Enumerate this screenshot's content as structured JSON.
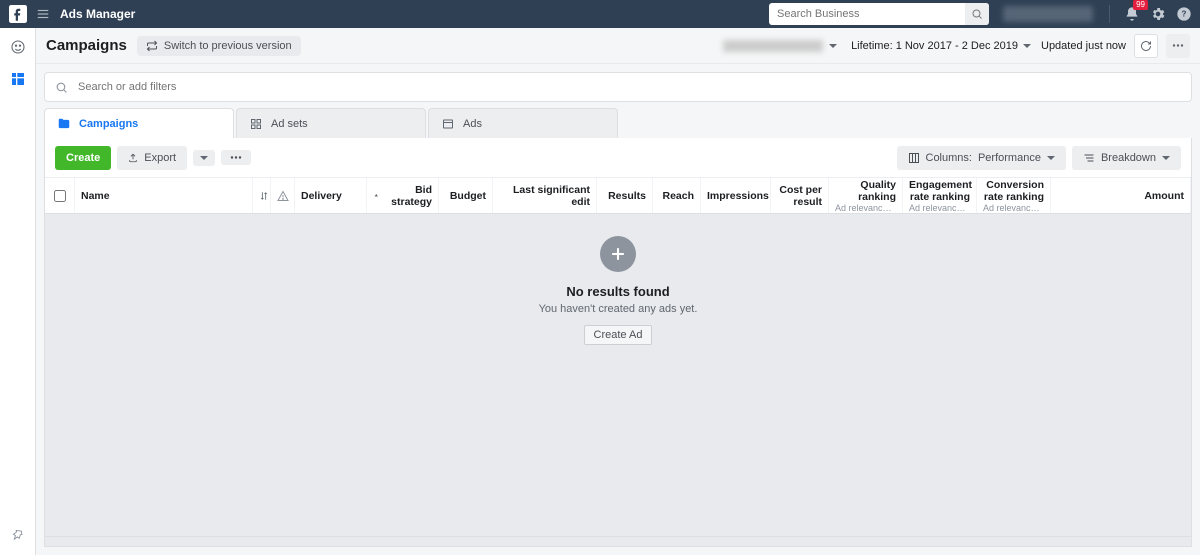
{
  "topbar": {
    "title": "Ads Manager",
    "search_placeholder": "Search Business",
    "notification_count": "99"
  },
  "page": {
    "title": "Campaigns",
    "switch_label": "Switch to previous version",
    "date_range": "Lifetime: 1 Nov 2017 - 2 Dec 2019",
    "updated_label": "Updated just now"
  },
  "filter": {
    "placeholder": "Search or add filters"
  },
  "tabs": [
    {
      "id": "campaigns",
      "label": "Campaigns",
      "icon": "folder-icon",
      "active": true
    },
    {
      "id": "adsets",
      "label": "Ad sets",
      "icon": "grid-icon",
      "active": false
    },
    {
      "id": "ads",
      "label": "Ads",
      "icon": "window-icon",
      "active": false
    }
  ],
  "toolbar": {
    "create_label": "Create",
    "export_label": "Export",
    "columns_prefix": "Columns:",
    "columns_value": "Performance",
    "breakdown_label": "Breakdown"
  },
  "columns": {
    "name": "Name",
    "delivery": "Delivery",
    "bid": "Bid strategy",
    "budget": "Budget",
    "last_edit": "Last significant edit",
    "results": "Results",
    "reach": "Reach",
    "impressions": "Impressions",
    "cost_per_result": "Cost per result",
    "quality_ranking": "Quality ranking",
    "engagement_ranking": "Engagement rate ranking",
    "conversion_ranking": "Conversion rate ranking",
    "amount": "Amount",
    "ad_relevance_sub": "Ad relevance dia..."
  },
  "empty": {
    "title": "No results found",
    "subtitle": "You haven't created any ads yet.",
    "cta": "Create Ad"
  }
}
